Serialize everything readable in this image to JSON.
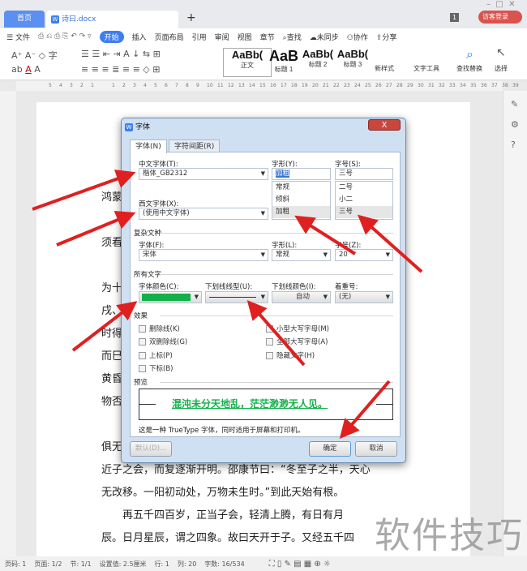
{
  "window": {
    "home_tab": "首页",
    "doc_tab": "诗曰.docx",
    "page_badge": "1",
    "login": "访客登录"
  },
  "menu": {
    "items": [
      "文件",
      "开始",
      "插入",
      "页面布局",
      "引用",
      "审阅",
      "视图",
      "章节"
    ],
    "find": "查找",
    "sync": "未同步",
    "collab": "协作",
    "share": "分享"
  },
  "ribbon": {
    "styles": [
      {
        "preview": "AaBb(",
        "name": "正文"
      },
      {
        "preview": "AaB",
        "name": "标题 1"
      },
      {
        "preview": "AaBb(",
        "name": "标题 2"
      },
      {
        "preview": "AaBb(",
        "name": "标题 3"
      }
    ],
    "new_style": "新样式",
    "text_tools": "文字工具",
    "find_replace": "查找替换",
    "select": "选择"
  },
  "ruler": {
    "ticks": [
      "5",
      "4",
      "3",
      "2",
      "1",
      "",
      "1",
      "2",
      "3",
      "4",
      "5",
      "6",
      "7",
      "8",
      "9",
      "10",
      "11",
      "12",
      "13",
      "14",
      "15",
      "16",
      "17",
      "18",
      "19",
      "20",
      "21",
      "22",
      "23",
      "24",
      "25",
      "26",
      "27",
      "28",
      "29",
      "30",
      "31",
      "32",
      "33",
      "34",
      "35",
      "36",
      "37",
      "38",
      "39"
    ]
  },
  "document": {
    "lines": [
      "鸿蒙",
      "须看",
      "为十",
      "戌、",
      "时得",
      "而巳",
      "黄昏",
      "物否",
      "俱无",
      "近子之会，而复逐渐开明。邵康节曰：“冬至子之半，天心",
      "无改移。一阳初动处，万物未生时。”到此天始有根。",
      "再五千四百岁，正当子会，轻清上腾，有日有月",
      "辰。日月星辰，谓之四象。故曰天开于子。又经五千四"
    ]
  },
  "dialog": {
    "title": "字体",
    "close": "X",
    "tabs": [
      "字体(N)",
      "字符间距(R)"
    ],
    "chinese_font": {
      "label": "中文字体(T):",
      "value": "楷体_GB2312"
    },
    "western_font": {
      "label": "西文字体(X):",
      "value": "(使用中文字体)"
    },
    "style": {
      "label": "字形(Y):",
      "value": "加粗",
      "options": [
        "常规",
        "倾斜",
        "加粗"
      ]
    },
    "size": {
      "label": "字号(S):",
      "value": "三号",
      "options": [
        "二号",
        "小二",
        "三号"
      ]
    },
    "complex": {
      "section": "复杂文种",
      "font_label": "字体(F):",
      "font": "宋体",
      "style_label": "字形(L):",
      "style": "常规",
      "size_label": "字号(Z):",
      "size": "20"
    },
    "all_text": {
      "section": "所有文字",
      "color_label": "字体颜色(C):",
      "color": "#13b04a",
      "underline_label": "下划线线型(U):",
      "underline_color_label": "下划线颜色(I):",
      "underline_color": "自动",
      "emphasis_label": "着重号:",
      "emphasis": "(无)"
    },
    "effects": {
      "section": "效果",
      "left": [
        "删除线(K)",
        "双删除线(G)",
        "上标(P)",
        "下标(B)"
      ],
      "right": [
        "小型大写字母(M)",
        "全部大写字母(A)",
        "隐藏文字(H)"
      ]
    },
    "preview": {
      "section": "预览",
      "text": "混沌未分天地乱，茫茫渺渺无人见。",
      "note": "这是一种 TrueType 字体，同时适用于屏幕和打印机。"
    },
    "buttons": {
      "default": "默认(D)...",
      "ok": "确定",
      "cancel": "取消"
    }
  },
  "status": {
    "items": [
      "页码: 1",
      "页面: 1/2",
      "节: 1/1",
      "设置值: 2.5厘米",
      "行: 1",
      "列: 20",
      "字数: 16/534"
    ]
  },
  "watermark": "软件技巧",
  "colors": {
    "accent": "#3d7ef0",
    "arrow": "#e02020",
    "font_color": "#13b04a"
  }
}
